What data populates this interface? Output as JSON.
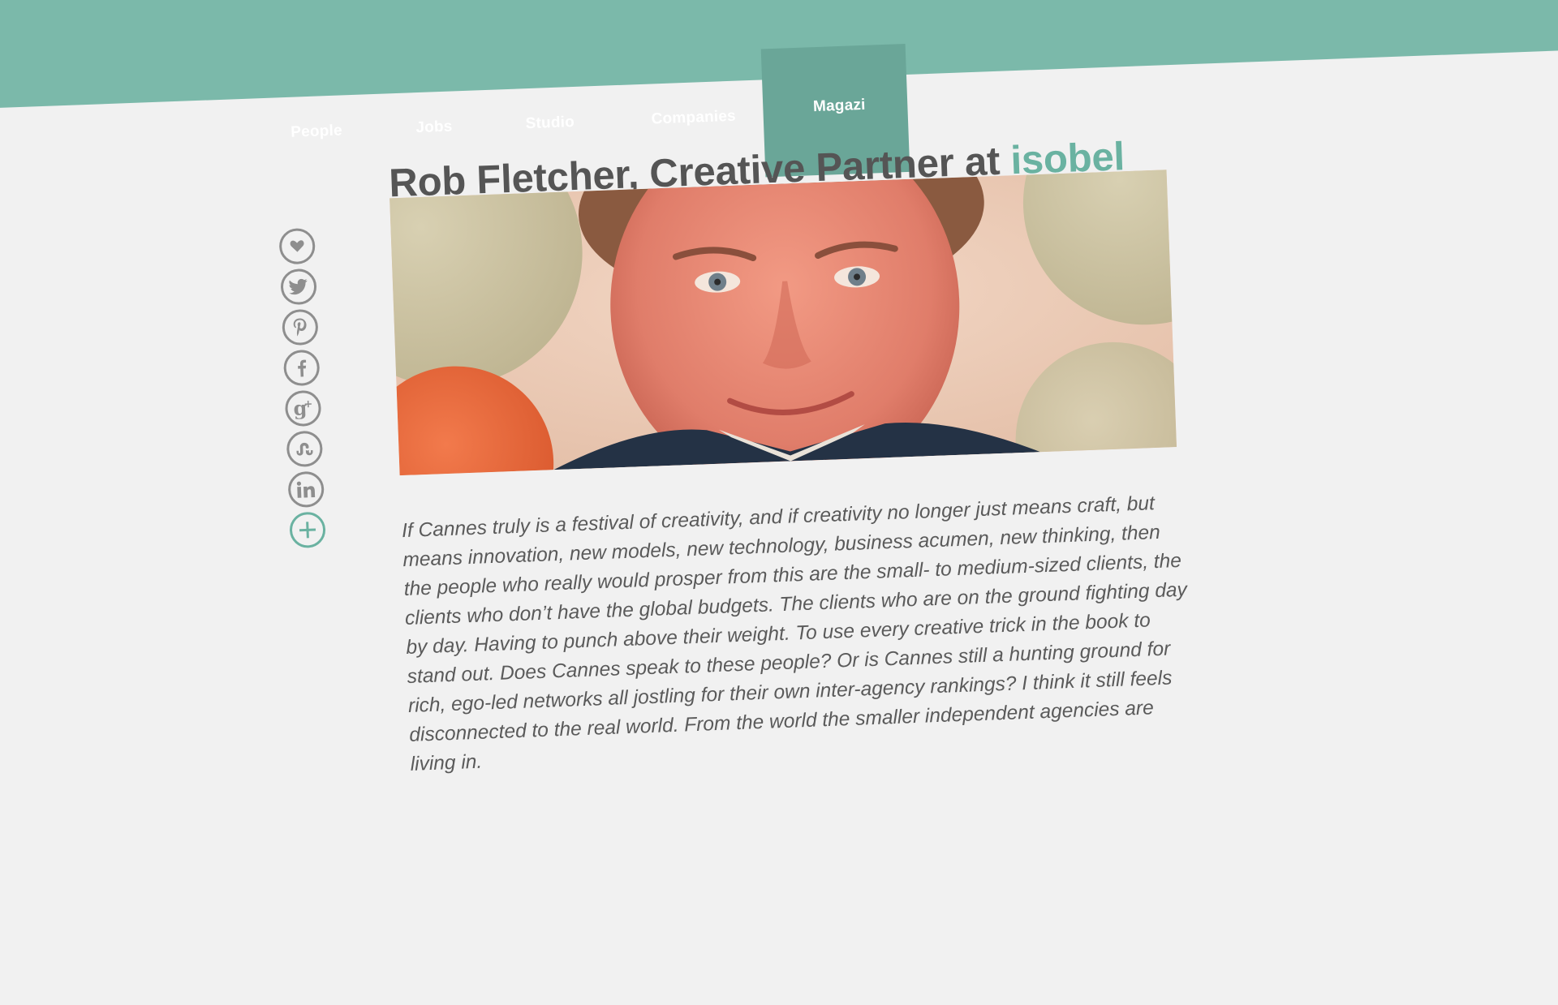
{
  "nav": {
    "items": [
      {
        "label": "People"
      },
      {
        "label": "Jobs"
      },
      {
        "label": "Studio"
      },
      {
        "label": "Companies"
      },
      {
        "label": "Magazi"
      }
    ]
  },
  "article": {
    "title_prefix": "Rob Fletcher, Creative Partner at ",
    "company_link": "isobel",
    "quote": "If Cannes truly is a festival of creativity, and if creativity no longer just means craft, but means innovation, new models, new technology, business acumen, new thinking, then the people who really would prosper from this are the small- to medium-sized clients, the clients who don’t have the global budgets. The clients who are on the ground fighting day by day. Having to punch above their weight. To use every creative trick in the book to stand out. Does Cannes speak to these people? Or is Cannes still a hunting ground for rich, ego-led networks all jostling for their own inter-agency rankings? I think it still feels disconnected to the real world. From the world the smaller independent agencies are living in."
  },
  "share": {
    "buttons": [
      {
        "icon": "heart-icon"
      },
      {
        "icon": "twitter-icon"
      },
      {
        "icon": "pinterest-icon"
      },
      {
        "icon": "facebook-icon"
      },
      {
        "icon": "google-plus-icon"
      },
      {
        "icon": "stumbleupon-icon"
      },
      {
        "icon": "linkedin-icon"
      },
      {
        "icon": "plus-icon"
      }
    ]
  },
  "colors": {
    "nav_bg": "#7bb9aa",
    "nav_active": "#6aa698",
    "accent": "#6ab2a1",
    "page_bg": "#f1f1f1",
    "text": "#555555",
    "icon_gray": "#8e8e8e"
  }
}
